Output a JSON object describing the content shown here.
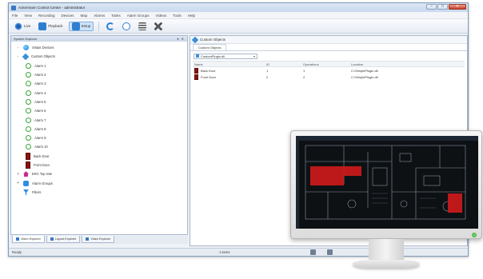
{
  "window": {
    "title": "Ackermann Control Center - administrator"
  },
  "menubar": [
    "File",
    "View",
    "Recording",
    "Devices",
    "Map",
    "Alarms",
    "Tasks",
    "Alarm Groups",
    "Videos",
    "Tools",
    "Help"
  ],
  "toolbar": {
    "live_label": "Live",
    "playback_label": "Playback",
    "setup_label": "Setup"
  },
  "left_panel": {
    "header": "System Explorer",
    "tree": [
      {
        "label": "Sistas Devices",
        "icon": "globe-icon",
        "level": 1,
        "expander": "-"
      },
      {
        "label": "Custom Objects",
        "icon": "cube-icon",
        "level": 1,
        "expander": "-"
      },
      {
        "label": "Alarm 1",
        "icon": "ring-icon",
        "level": 2
      },
      {
        "label": "Alarm 2",
        "icon": "ring-icon",
        "level": 2
      },
      {
        "label": "Alarm 3",
        "icon": "ring-icon",
        "level": 2
      },
      {
        "label": "Alarm 4",
        "icon": "ring-icon",
        "level": 2
      },
      {
        "label": "Alarm 5",
        "icon": "ring-icon",
        "level": 2
      },
      {
        "label": "Alarm 6",
        "icon": "ring-icon",
        "level": 2
      },
      {
        "label": "Alarm 7",
        "icon": "ring-icon",
        "level": 2
      },
      {
        "label": "Alarm 8",
        "icon": "ring-icon",
        "level": 2
      },
      {
        "label": "Alarm 9",
        "icon": "ring-icon",
        "level": 2
      },
      {
        "label": "Alarm 10",
        "icon": "ring-icon",
        "level": 2
      },
      {
        "label": "Back Door",
        "icon": "door-icon",
        "level": 2
      },
      {
        "label": "Front Door",
        "icon": "door-icon",
        "level": 2
      },
      {
        "label": "ERC Top Site",
        "icon": "house-icon",
        "level": 1,
        "expander": "+"
      },
      {
        "label": "Alarm Groups",
        "icon": "bell-icon",
        "level": 1,
        "expander": "+"
      },
      {
        "label": "Filters",
        "icon": "funnel-icon",
        "level": 1,
        "expander": ""
      }
    ],
    "tabs": [
      "Video Explorer",
      "Layout Explorer",
      "Video Explorer"
    ]
  },
  "right_panel": {
    "header": "Custom Objects",
    "tab": "Custom Objects",
    "filter": "CustomPlugin.dll",
    "columns": [
      "Name",
      "ID",
      "Operations",
      "Location"
    ],
    "rows": [
      {
        "name": "Back Door",
        "id": "1",
        "operations": "1",
        "location": "C:\\SimplePlugin.dll"
      },
      {
        "name": "Front Door",
        "id": "2",
        "operations": "2",
        "location": "C:\\SimplePlugin.dll"
      }
    ]
  },
  "statusbar": {
    "left": "Ready",
    "middle": "1 items"
  },
  "colors": {
    "accent": "#3a8fd9",
    "door_red": "#8b1212",
    "map_highlight": "#c81a1a"
  }
}
